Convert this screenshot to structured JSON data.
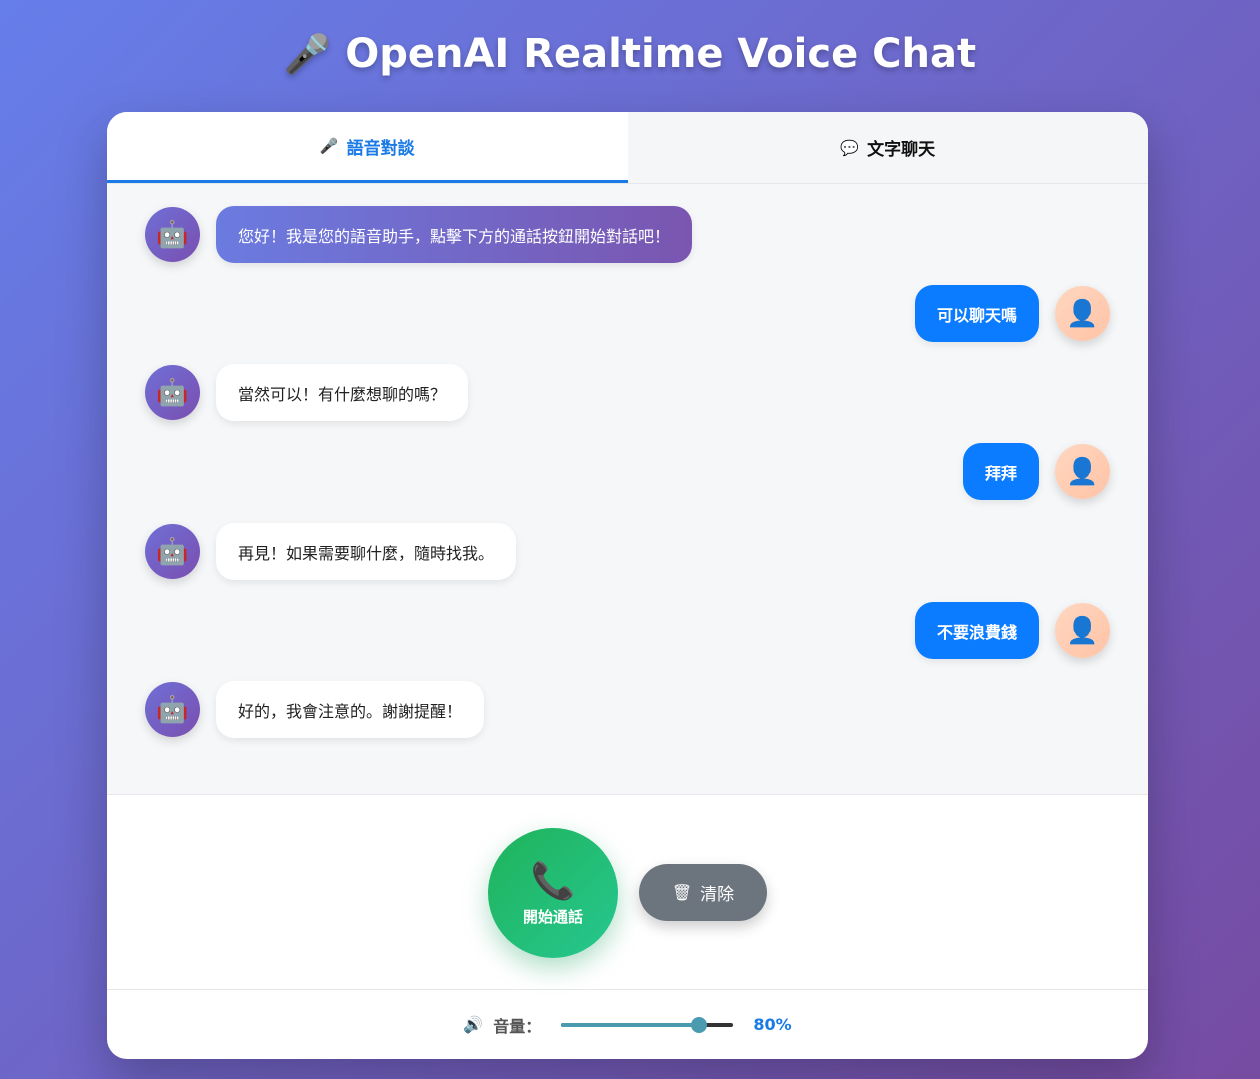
{
  "app": {
    "title": "OpenAI Realtime Voice Chat",
    "title_icon": "🎤"
  },
  "tabs": [
    {
      "icon": "🎤",
      "label": "語音對談",
      "active": true
    },
    {
      "icon": "💬",
      "label": "文字聊天",
      "active": false
    }
  ],
  "messages": [
    {
      "role": "assistant",
      "avatar": "🤖",
      "text": "您好！我是您的語音助手，點擊下方的通話按鈕開始對話吧！"
    },
    {
      "role": "user",
      "avatar": "👤",
      "text": "可以聊天嗎"
    },
    {
      "role": "assistant",
      "avatar": "🤖",
      "text": "當然可以！有什麼想聊的嗎？"
    },
    {
      "role": "user",
      "avatar": "👤",
      "text": "拜拜"
    },
    {
      "role": "assistant",
      "avatar": "🤖",
      "text": "再見！如果需要聊什麼，隨時找我。"
    },
    {
      "role": "user",
      "avatar": "👤",
      "text": "不要浪費錢"
    },
    {
      "role": "assistant",
      "avatar": "🤖",
      "text": "好的，我會注意的。謝謝提醒！"
    }
  ],
  "controls": {
    "call_icon": "📞",
    "call_label": "開始通話",
    "clear_icon": "🗑",
    "clear_label": "清除"
  },
  "volume": {
    "icon": "🔊",
    "label": "音量：",
    "value": 80,
    "value_text": "80%"
  },
  "colors": {
    "accent": "#1a7ae6",
    "user_bubble": "#0b7cff",
    "call_button": "#1fb35a",
    "clear_button": "#6c757d"
  }
}
